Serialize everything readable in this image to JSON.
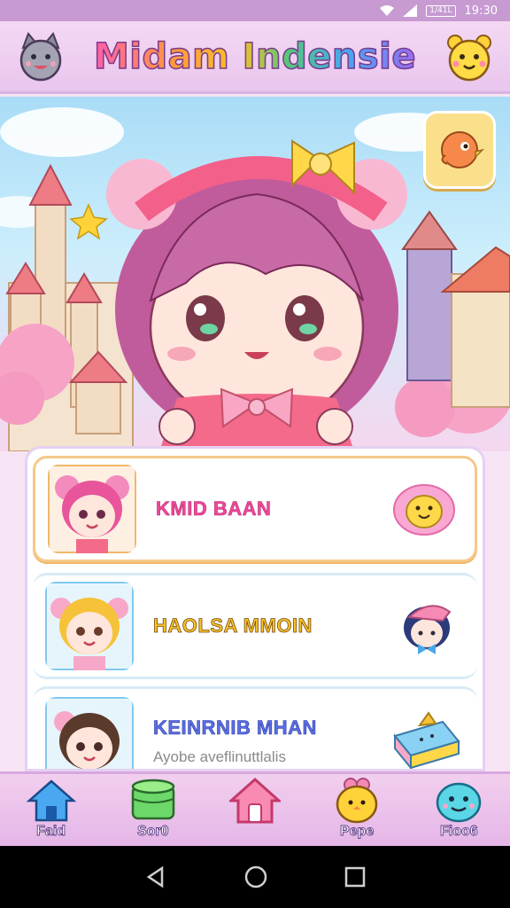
{
  "status_bar": {
    "time": "19:30",
    "battery_label": "1/41L"
  },
  "header": {
    "title": "Midam Indensie",
    "left_mascot": "cat-face-icon",
    "right_mascot": "yellow-bear-face-icon"
  },
  "hero": {
    "corner_button_icon": "orange-bird-icon"
  },
  "list": {
    "items": [
      {
        "name": "KMID BAAN",
        "subtitle": "",
        "avatar": "pink-hair-girl-avatar",
        "badge": "pink-blob-face-icon"
      },
      {
        "name": "HAOLSA MMOIN",
        "subtitle": "",
        "avatar": "blonde-girl-avatar",
        "badge": "blue-hair-boy-sticker-icon"
      },
      {
        "name": "KEINRNIB MHAN",
        "subtitle": "Ayobe aveflinuttlalis",
        "avatar": "brown-hair-girl-avatar",
        "badge": "gift-box-icon"
      }
    ]
  },
  "bottom_nav": {
    "items": [
      {
        "label": "Faid",
        "icon": "blue-house-icon"
      },
      {
        "label": "Sor0",
        "icon": "green-stack-icon"
      },
      {
        "label": "",
        "icon": "pink-home-icon"
      },
      {
        "label": "Pepe",
        "icon": "yellow-chick-icon"
      },
      {
        "label": "Fioo6",
        "icon": "cyan-blob-face-icon"
      }
    ]
  },
  "colors": {
    "header_bg": "#f4d8f3",
    "accent_pink": "#f0489a",
    "nav_bg": "#e5b6e8"
  }
}
